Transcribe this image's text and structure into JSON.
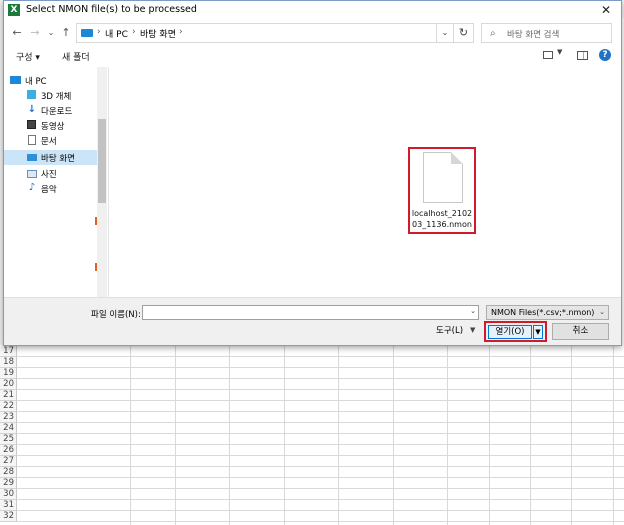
{
  "dialog": {
    "title": "Select NMON file(s) to be processed",
    "close_glyph": "✕"
  },
  "nav": {
    "back_glyph": "←",
    "forward_glyph": "→",
    "dropdown_glyph": "⌄",
    "up_glyph": "↑",
    "breadcrumb": [
      "내 PC",
      "바탕 화면"
    ],
    "separator": "›",
    "refresh_glyph": "↻",
    "search_placeholder": "바탕 화면 검색"
  },
  "toolbar": {
    "organize": "구성 ▾",
    "new_folder": "새 폴더",
    "help": "?"
  },
  "sidebar": {
    "items": [
      {
        "label": "내 PC",
        "icon": "pc-icon"
      },
      {
        "label": "3D 개체",
        "icon": "3d-objects-icon"
      },
      {
        "label": "다운로드",
        "icon": "download-icon"
      },
      {
        "label": "동영상",
        "icon": "video-icon"
      },
      {
        "label": "문서",
        "icon": "document-icon"
      },
      {
        "label": "바탕 화면",
        "icon": "desktop-icon",
        "selected": true
      },
      {
        "label": "사진",
        "icon": "pictures-icon"
      },
      {
        "label": "음악",
        "icon": "music-icon"
      }
    ]
  },
  "files": [
    {
      "name": "localhost_210203_1136.nmon",
      "icon": "file-icon"
    }
  ],
  "bottom": {
    "filename_label": "파일 이름(N):",
    "filename_value": "",
    "filetype": "NMON Files(*.csv;*.nmon)",
    "tools_label": "도구(L)",
    "open_label": "열기(O)",
    "cancel_label": "취소"
  },
  "sheet": {
    "app_icon": "X",
    "rows": [
      "17",
      "18",
      "19",
      "20",
      "21",
      "22",
      "23",
      "24",
      "25",
      "26",
      "27",
      "28",
      "29",
      "30",
      "31",
      "32"
    ]
  },
  "colors": {
    "selection": "#cce4f7",
    "highlight_box": "#d11a2a",
    "primary_border": "#0078d7"
  }
}
